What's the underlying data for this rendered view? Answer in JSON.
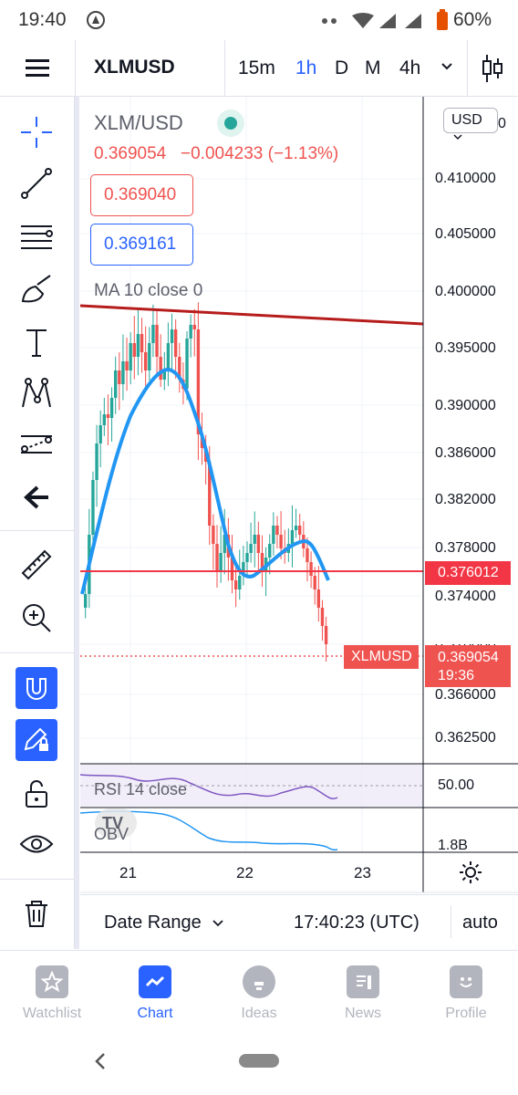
{
  "status": {
    "time": "19:40",
    "battery": "60%"
  },
  "header": {
    "symbol": "XLMUSD",
    "timeframes": [
      "15m",
      "1h",
      "D",
      "M",
      "4h"
    ],
    "active_timeframe": "1h"
  },
  "chart": {
    "legend": {
      "pair": "XLM/USD",
      "price": "0.369054",
      "change": "−0.004233 (−1.13%)",
      "sell_price": "0.369040",
      "buy_price": "0.369161",
      "ma_label": "MA 10 close 0"
    },
    "currency": "USD",
    "price_labels": [
      "0.410000",
      "0.405000",
      "0.400000",
      "0.395000",
      "0.390000",
      "0.386000",
      "0.382000",
      "0.378000",
      "0.374000",
      "0.370000",
      "0.366000",
      "0.362500"
    ],
    "hline_price": "0.376012",
    "last_symbol": "XLMUSD",
    "last_price": "0.369054",
    "countdown": "19:36",
    "rsi_label": "RSI 14 close",
    "rsi_value": "50.00",
    "obv_label": "OBV",
    "obv_value": "1.8B",
    "x_labels": [
      "21",
      "22",
      "23"
    ],
    "colors": {
      "up": "#26a69a",
      "down": "#ef5350",
      "ma": "#2196f3",
      "trend": "#b71c1c",
      "hline": "#f23645"
    }
  },
  "footer": {
    "date_range": "Date Range",
    "clock": "17:40:23 (UTC)",
    "scale": "auto"
  },
  "bottom_nav": [
    {
      "label": "Watchlist"
    },
    {
      "label": "Chart"
    },
    {
      "label": "Ideas"
    },
    {
      "label": "News"
    },
    {
      "label": "Profile"
    }
  ]
}
